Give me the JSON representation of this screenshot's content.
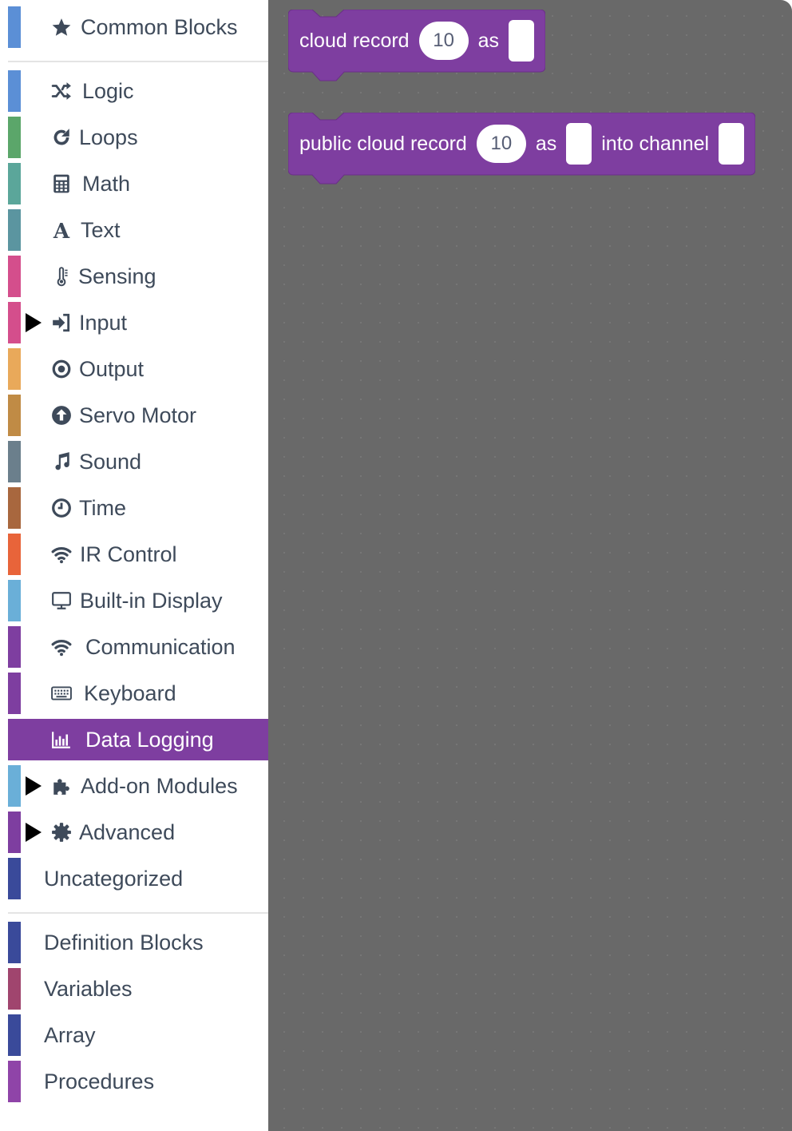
{
  "toolbox": {
    "categories": [
      {
        "label": "Common Blocks",
        "color": "#5b8fd6",
        "icon": "star-icon",
        "arrow": false
      },
      {
        "label": "Logic",
        "color": "#5b8fd6",
        "icon": "shuffle-icon",
        "arrow": false
      },
      {
        "label": "Loops",
        "color": "#5ba66a",
        "icon": "redo-icon",
        "arrow": false
      },
      {
        "label": "Math",
        "color": "#5ba69a",
        "icon": "calculator-icon",
        "arrow": false
      },
      {
        "label": "Text",
        "color": "#5b95a0",
        "icon": "font-icon",
        "arrow": false
      },
      {
        "label": "Sensing",
        "color": "#d44e8c",
        "icon": "thermometer-icon",
        "arrow": false
      },
      {
        "label": "Input",
        "color": "#d44e8c",
        "icon": "sign-in-icon",
        "arrow": true
      },
      {
        "label": "Output",
        "color": "#e9a95a",
        "icon": "dot-circle-icon",
        "arrow": false
      },
      {
        "label": "Servo Motor",
        "color": "#c08b45",
        "icon": "arrow-circle-up-icon",
        "arrow": false
      },
      {
        "label": "Sound",
        "color": "#6b7f8c",
        "icon": "music-icon",
        "arrow": false
      },
      {
        "label": "Time",
        "color": "#a8673e",
        "icon": "clock-icon",
        "arrow": false
      },
      {
        "label": "IR Control",
        "color": "#e8643a",
        "icon": "wifi-icon",
        "arrow": false
      },
      {
        "label": "Built-in Display",
        "color": "#6aafd8",
        "icon": "desktop-icon",
        "arrow": false
      },
      {
        "label": "Communication",
        "color": "#7e3ea0",
        "icon": "wifi-icon",
        "arrow": false
      },
      {
        "label": "Keyboard",
        "color": "#7e3ea0",
        "icon": "keyboard-icon",
        "arrow": false
      },
      {
        "label": "Data Logging",
        "color": "#7e3ea0",
        "icon": "bar-chart-icon",
        "arrow": false,
        "selected": true
      },
      {
        "label": "Add-on Modules",
        "color": "#6aafd8",
        "icon": "puzzle-icon",
        "arrow": true
      },
      {
        "label": "Advanced",
        "color": "#7e3ea0",
        "icon": "cog-icon",
        "arrow": true
      },
      {
        "label": "Uncategorized",
        "color": "#3a4a9a",
        "icon": "",
        "arrow": false
      },
      {
        "label": "Definition Blocks",
        "color": "#3a4a9a",
        "icon": "",
        "arrow": false
      },
      {
        "label": "Variables",
        "color": "#a0456e",
        "icon": "",
        "arrow": false
      },
      {
        "label": "Array",
        "color": "#3a4a9a",
        "icon": "",
        "arrow": false
      },
      {
        "label": "Procedures",
        "color": "#8f44a8",
        "icon": "",
        "arrow": false
      }
    ]
  },
  "workspace": {
    "blocks": [
      {
        "name": "cloud-record-block",
        "parts": [
          {
            "kind": "text",
            "value": "cloud record"
          },
          {
            "kind": "number",
            "value": "10"
          },
          {
            "kind": "text",
            "value": "as"
          },
          {
            "kind": "slot",
            "value": ""
          }
        ]
      },
      {
        "name": "public-cloud-record-block",
        "parts": [
          {
            "kind": "text",
            "value": "public cloud record"
          },
          {
            "kind": "number",
            "value": "10"
          },
          {
            "kind": "text",
            "value": "as"
          },
          {
            "kind": "slot",
            "value": ""
          },
          {
            "kind": "text",
            "value": "into channel"
          },
          {
            "kind": "slot",
            "value": ""
          }
        ]
      }
    ],
    "block_color": "#7e3ea0"
  }
}
